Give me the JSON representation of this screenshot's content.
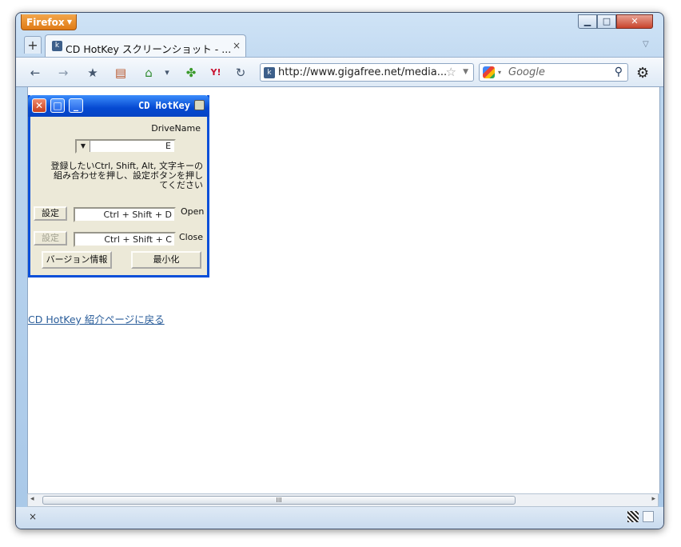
{
  "browser": {
    "menu_button": "Firefox",
    "window_buttons": {
      "minimize": "▁",
      "maximize": "□",
      "close": "✕"
    },
    "new_tab": "+",
    "tab": {
      "title": "CD HotKey スクリーンショット - ...",
      "close": "×"
    },
    "tab_list_arrow": "▽",
    "nav": {
      "back": "←",
      "forward": "→",
      "bookmarks": "★",
      "library": "▤",
      "home": "⌂",
      "menu_arrow": "▾",
      "addon": "✤",
      "yahoo": "Y!",
      "reload": "↻"
    },
    "url": "http://www.gigafree.net/media...",
    "url_star": "☆",
    "url_drop": "▼",
    "search": {
      "placeholder": "Google",
      "engine_arrow": "▾",
      "go": "⚲"
    },
    "settings_icon": "⚙"
  },
  "app": {
    "title": "CD HotKey",
    "drive_label": "DriveName",
    "drive_value": "E",
    "instructions": "登録したいCtrl, Shift, Alt, 文字キーの組み合わせを押し、設定ボタンを押してください",
    "open_label": "Open",
    "open_value": "Ctrl + Shift + D",
    "open_button": "設定",
    "close_label": "Close",
    "close_value": "Ctrl + Shift + C",
    "close_button": "設定",
    "minimize_button": "最小化",
    "version_button": "バージョン情報"
  },
  "page_link": "CD HotKey 紹介ページに戻る",
  "scrollbar": {
    "left": "◂",
    "right": "▸",
    "grip": "III"
  },
  "status": {
    "close": "×"
  }
}
